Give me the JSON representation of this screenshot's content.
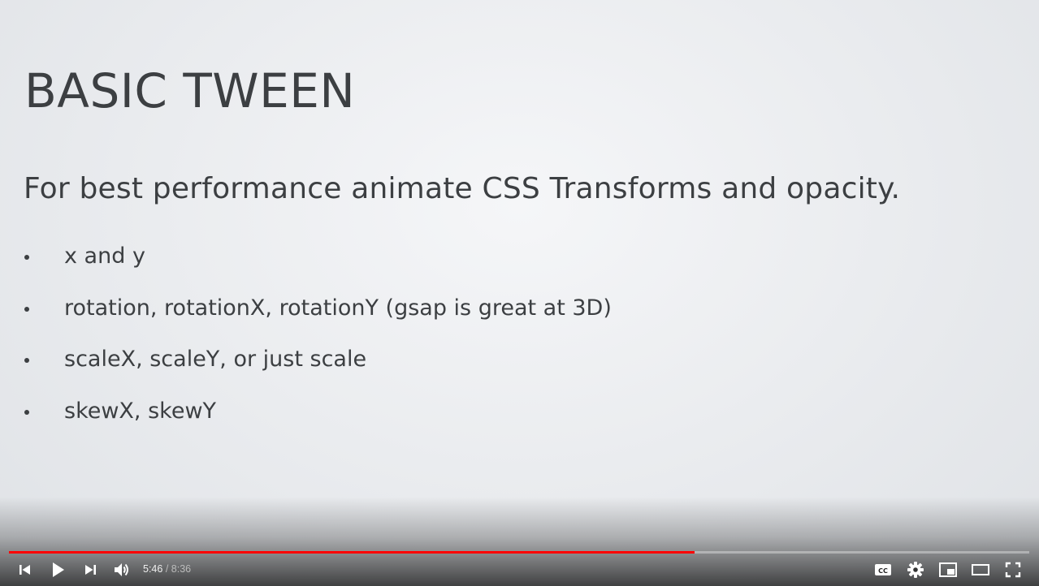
{
  "slide": {
    "title": "BASIC TWEEN",
    "subtitle": "For best performance animate CSS Transforms and opacity.",
    "bullets": [
      "x and y",
      "rotation, rotationX, rotationY (gsap is great at 3D)",
      "scaleX, scaleY, or just scale",
      "skewX, skewY"
    ]
  },
  "player": {
    "current_time": "5:46",
    "separator": "/",
    "duration": "8:36",
    "progress_fraction": 0.672,
    "accent_color": "#ff0000",
    "icons": {
      "previous": "skip-previous-icon",
      "play": "play-icon",
      "next": "skip-next-icon",
      "volume": "volume-icon",
      "captions": "closed-captions-icon",
      "settings": "gear-icon",
      "miniplayer": "miniplayer-icon",
      "theater": "theater-mode-icon",
      "fullscreen": "fullscreen-icon"
    }
  }
}
